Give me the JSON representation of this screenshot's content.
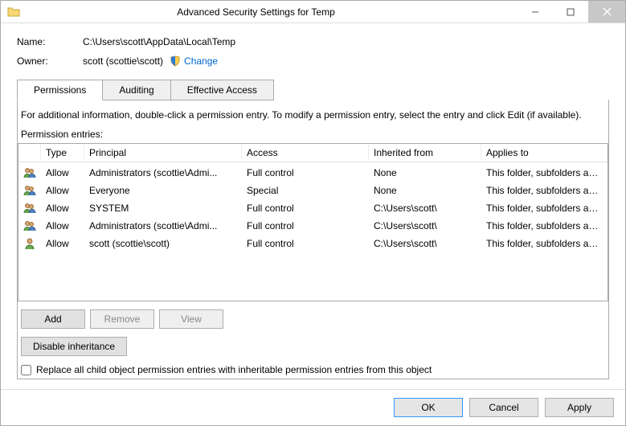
{
  "titlebar": {
    "title": "Advanced Security Settings for Temp"
  },
  "name_label": "Name:",
  "name_value": "C:\\Users\\scott\\AppData\\Local\\Temp",
  "owner_label": "Owner:",
  "owner_value": "scott (scottie\\scott)",
  "change_label": "Change",
  "tabs": {
    "permissions": "Permissions",
    "auditing": "Auditing",
    "effective": "Effective Access"
  },
  "info_text": "For additional information, double-click a permission entry. To modify a permission entry, select the entry and click Edit (if available).",
  "perm_entries_label": "Permission entries:",
  "headers": {
    "type": "Type",
    "principal": "Principal",
    "access": "Access",
    "inherited": "Inherited from",
    "applies": "Applies to"
  },
  "entries": [
    {
      "icon": "group",
      "type": "Allow",
      "principal": "Administrators (scottie\\Admi...",
      "access": "Full control",
      "inherited": "None",
      "applies": "This folder, subfolders and files"
    },
    {
      "icon": "group",
      "type": "Allow",
      "principal": "Everyone",
      "access": "Special",
      "inherited": "None",
      "applies": "This folder, subfolders and files"
    },
    {
      "icon": "group",
      "type": "Allow",
      "principal": "SYSTEM",
      "access": "Full control",
      "inherited": "C:\\Users\\scott\\",
      "applies": "This folder, subfolders and files"
    },
    {
      "icon": "group",
      "type": "Allow",
      "principal": "Administrators (scottie\\Admi...",
      "access": "Full control",
      "inherited": "C:\\Users\\scott\\",
      "applies": "This folder, subfolders and files"
    },
    {
      "icon": "user",
      "type": "Allow",
      "principal": "scott (scottie\\scott)",
      "access": "Full control",
      "inherited": "C:\\Users\\scott\\",
      "applies": "This folder, subfolders and files"
    }
  ],
  "buttons": {
    "add": "Add",
    "remove": "Remove",
    "view": "View",
    "disable_inherit": "Disable inheritance",
    "ok": "OK",
    "cancel": "Cancel",
    "apply": "Apply"
  },
  "replace_checkbox": "Replace all child object permission entries with inheritable permission entries from this object"
}
